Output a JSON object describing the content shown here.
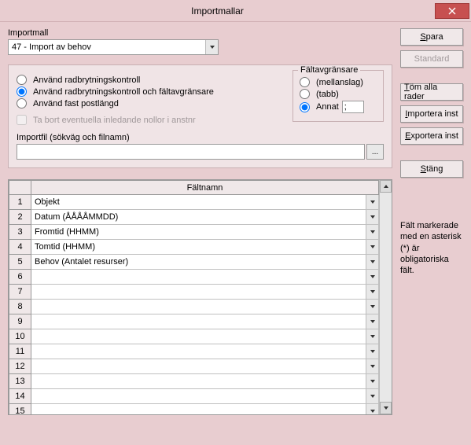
{
  "window": {
    "title": "Importmallar"
  },
  "importmall": {
    "label": "Importmall",
    "value": "47 - Import av behov"
  },
  "options": {
    "radio1": "Använd radbrytningskontroll",
    "radio2": "Använd radbrytningskontroll och fältavgränsare",
    "radio3": "Använd fast postlängd",
    "selected": "radio2",
    "checkbox": "Ta bort eventuella inledande nollor i anstnr"
  },
  "delimiter": {
    "legend": "Fältavgränsare",
    "opt1": "(mellanslag)",
    "opt2": "(tabb)",
    "opt3": "Annat",
    "selected": "opt3",
    "annat_value": ";"
  },
  "importfile": {
    "label": "Importfil (sökväg och filnamn)",
    "value": "",
    "browse": "..."
  },
  "buttons": {
    "spara": "Spara",
    "standard": "Standard",
    "tomalla": "Töm alla rader",
    "importera": "Importera inst",
    "exportera": "Exportera inst",
    "stang": "Stäng"
  },
  "table": {
    "header": "Fältnamn",
    "rows": [
      {
        "n": "1",
        "v": "Objekt"
      },
      {
        "n": "2",
        "v": "Datum (ÅÅÅÅMMDD)"
      },
      {
        "n": "3",
        "v": "Fromtid (HHMM)"
      },
      {
        "n": "4",
        "v": "Tomtid (HHMM)"
      },
      {
        "n": "5",
        "v": "Behov (Antalet resurser)"
      },
      {
        "n": "6",
        "v": ""
      },
      {
        "n": "7",
        "v": ""
      },
      {
        "n": "8",
        "v": ""
      },
      {
        "n": "9",
        "v": ""
      },
      {
        "n": "10",
        "v": ""
      },
      {
        "n": "11",
        "v": ""
      },
      {
        "n": "12",
        "v": ""
      },
      {
        "n": "13",
        "v": ""
      },
      {
        "n": "14",
        "v": ""
      },
      {
        "n": "15",
        "v": ""
      }
    ]
  },
  "helptext": "Fält markerade med en asterisk (*) är obligatoriska fält."
}
